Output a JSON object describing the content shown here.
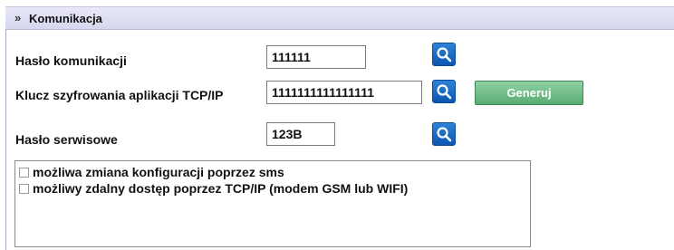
{
  "header": {
    "title": "Komunikacja",
    "collapse_icon": "double-chevron-up-icon"
  },
  "rows": [
    {
      "label": "Hasło komunikacji",
      "value": "111111"
    },
    {
      "label": "Klucz szyfrowania aplikacji TCP/IP",
      "value": "1111111111111111"
    },
    {
      "label": "Hasło serwisowe",
      "value": "123B"
    }
  ],
  "generate_button": {
    "label": "Generuj"
  },
  "options": [
    {
      "label": "możliwa zmiana konfiguracji poprzez sms",
      "checked": false
    },
    {
      "label": "możliwy zdalny dostęp poprzez TCP/IP (modem GSM lub WIFI)",
      "checked": false
    }
  ],
  "colors": {
    "accent": "#1a6fc8",
    "generate": "#6dbb85",
    "header": "#dcdcf0"
  }
}
